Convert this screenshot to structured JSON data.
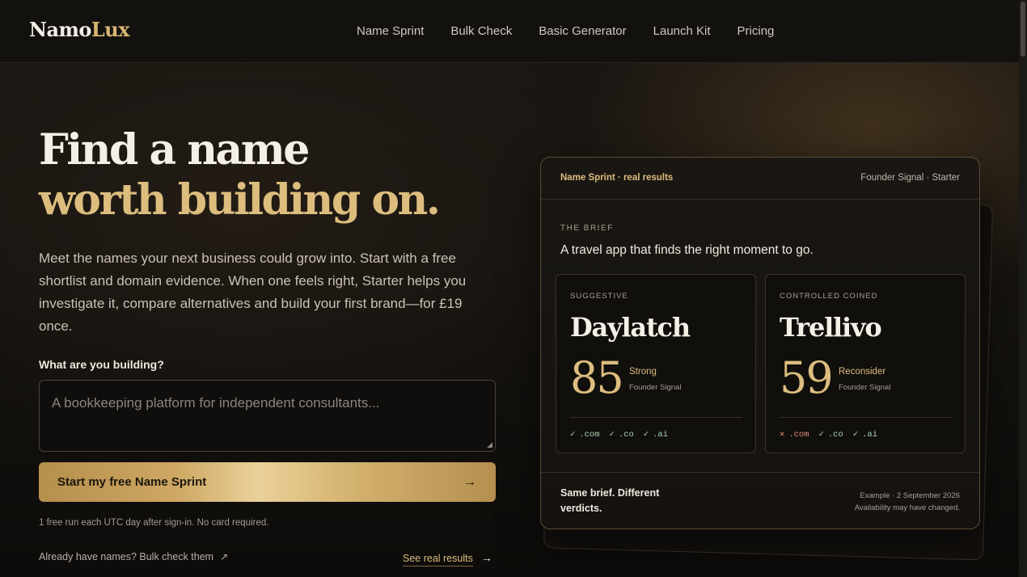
{
  "brand": {
    "name_part1": "Namo",
    "name_part2": "Lux",
    "accent_color": "#d9b774"
  },
  "nav": {
    "items": [
      {
        "label": "Name Sprint"
      },
      {
        "label": "Bulk Check"
      },
      {
        "label": "Basic Generator"
      },
      {
        "label": "Launch Kit"
      },
      {
        "label": "Pricing"
      }
    ]
  },
  "hero": {
    "title_line1": "Find a name",
    "title_line2": "worth building on.",
    "intro": "Meet the names your next business could grow into. Start with a free shortlist and domain evidence. When one feels right, Starter helps you investigate it, compare alternatives and build your first brand—for £19 once.",
    "field_label": "What are you building?",
    "field_placeholder": "A bookkeeping platform for independent consultants...",
    "field_value": "",
    "cta_label": "Start my free Name Sprint",
    "cta_icon": "arrow-right-icon",
    "fine_print": "1 free run each UTC day after sign-in. No card required.",
    "bulk_link": "Already have names? Bulk check them",
    "results_link": "See real results"
  },
  "result_card": {
    "header_left": "Name Sprint · real results",
    "header_right": "Founder Signal · Starter",
    "brief_kicker": "THE BRIEF",
    "brief_text": "A travel app that finds the right moment to go.",
    "names": [
      {
        "kicker": "SUGGESTIVE",
        "name": "Daylatch",
        "score": "85",
        "verdict": "Strong",
        "signal": "Founder Signal",
        "domains": [
          {
            "mark": "✓",
            "tld": ".com",
            "available": true
          },
          {
            "mark": "✓",
            "tld": ".co",
            "available": true
          },
          {
            "mark": "✓",
            "tld": ".ai",
            "available": true
          }
        ]
      },
      {
        "kicker": "CONTROLLED COINED",
        "name": "Trellivo",
        "score": "59",
        "verdict": "Reconsider",
        "signal": "Founder Signal",
        "domains": [
          {
            "mark": "✕",
            "tld": ".com",
            "available": false
          },
          {
            "mark": "✓",
            "tld": ".co",
            "available": true
          },
          {
            "mark": "✓",
            "tld": ".ai",
            "available": true
          }
        ]
      }
    ],
    "footer_left": "Same brief. Different verdicts.",
    "footer_right_line1": "Example · 2 September 2026",
    "footer_right_line2": "Availability may have changed."
  },
  "colors": {
    "background": "#0f0d0b",
    "gold": "#dcbd7e",
    "available_green": "#a9d6b4",
    "unavailable_red": "#e08a7a"
  }
}
